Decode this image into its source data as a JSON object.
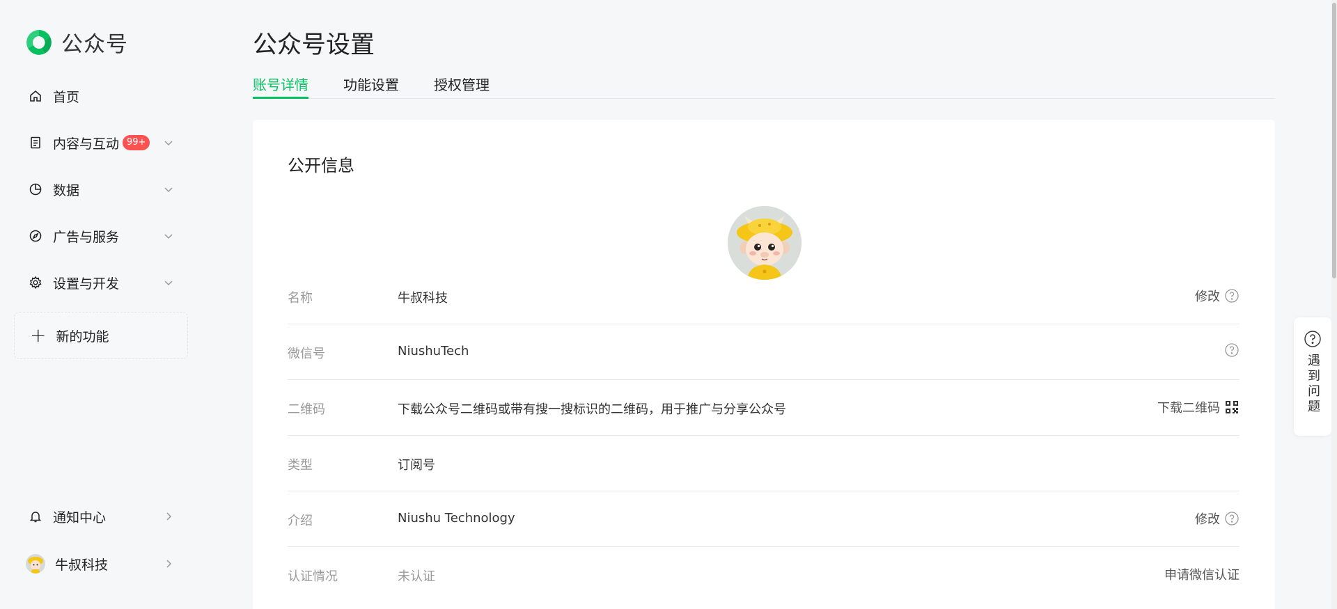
{
  "app": {
    "name": "公众号",
    "brand_color": "#07c160"
  },
  "sidebar": {
    "items": [
      {
        "label": "首页",
        "icon": "home-icon"
      },
      {
        "label": "内容与互动",
        "icon": "document-icon",
        "badge": "99+"
      },
      {
        "label": "数据",
        "icon": "pie-chart-icon"
      },
      {
        "label": "广告与服务",
        "icon": "compass-icon"
      },
      {
        "label": "设置与开发",
        "icon": "gear-icon"
      }
    ],
    "new_feature": "新的功能",
    "notification": "通知中心",
    "account": "牛叔科技"
  },
  "page": {
    "title": "公众号设置",
    "tabs": [
      {
        "label": "账号详情",
        "active": true
      },
      {
        "label": "功能设置",
        "active": false
      },
      {
        "label": "授权管理",
        "active": false
      }
    ]
  },
  "card": {
    "title": "公开信息",
    "rows": [
      {
        "label": "名称",
        "value": "牛叔科技",
        "action": "修改"
      },
      {
        "label": "微信号",
        "value": "NiushuTech"
      },
      {
        "label": "二维码",
        "value": "下载公众号二维码或带有搜一搜标识的二维码，用于推广与分享公众号",
        "action": "下载二维码"
      },
      {
        "label": "类型",
        "value": "订阅号"
      },
      {
        "label": "介绍",
        "value": "Niushu Technology",
        "action": "修改"
      },
      {
        "label": "认证情况",
        "value": "未认证",
        "action": "申请微信认证"
      }
    ]
  },
  "help": {
    "label": "遇到问题"
  }
}
